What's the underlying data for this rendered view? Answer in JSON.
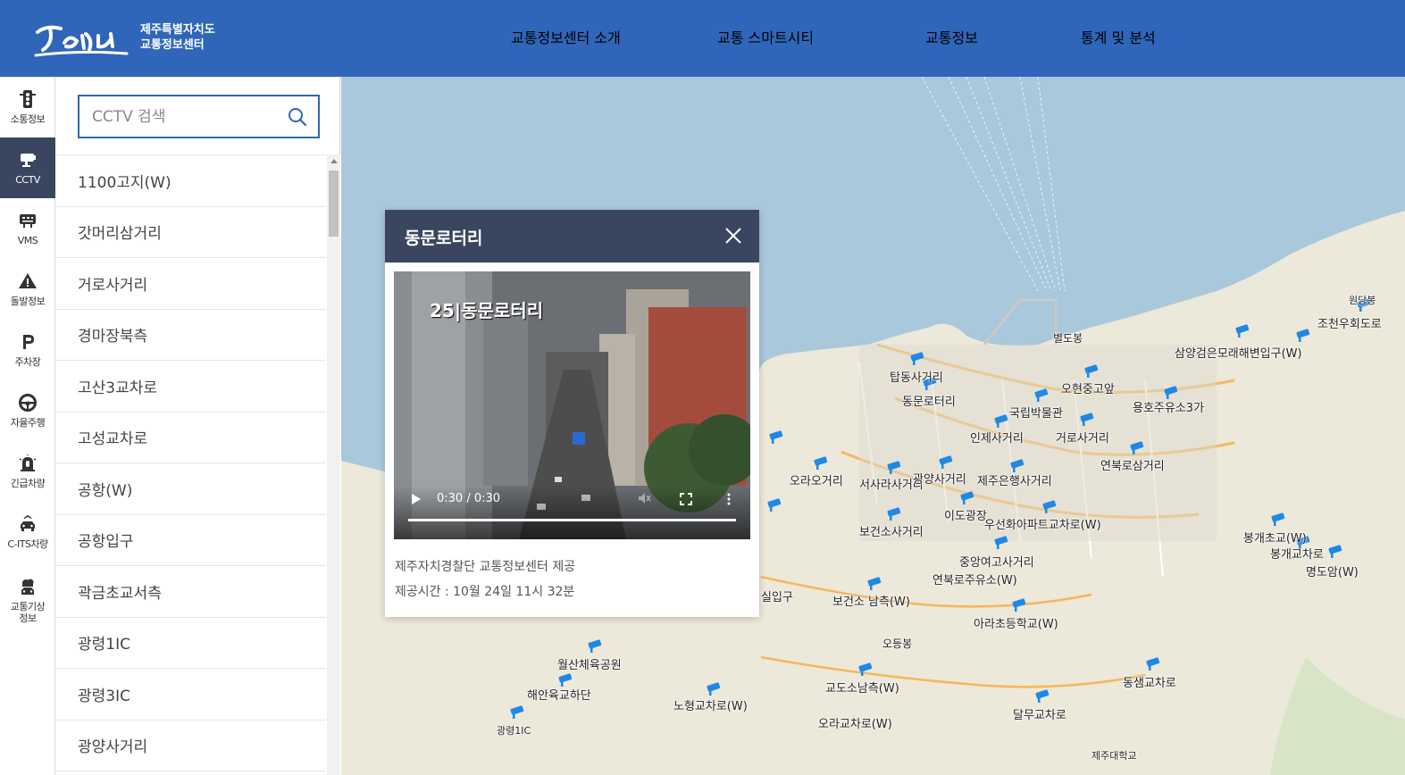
{
  "header": {
    "logo_text": "Jeju",
    "org_line1": "제주특별자치도",
    "org_line2": "교통정보센터",
    "nav": [
      "교통정보센터 소개",
      "교통 스마트시티",
      "교통정보",
      "통계 및 분석"
    ]
  },
  "rail": [
    {
      "label": "소통정보",
      "icon": "traffic-light-icon"
    },
    {
      "label": "CCTV",
      "icon": "cctv-icon",
      "active": true
    },
    {
      "label": "VMS",
      "icon": "vms-icon"
    },
    {
      "label": "돌발정보",
      "icon": "warning-icon"
    },
    {
      "label": "주차장",
      "icon": "parking-icon"
    },
    {
      "label": "자율주행",
      "icon": "steering-wheel-icon"
    },
    {
      "label": "긴급차량",
      "icon": "emergency-icon"
    },
    {
      "label": "C-ITS차량",
      "icon": "car-icon"
    },
    {
      "label": "교통기상\n정보",
      "icon": "weather-icon"
    }
  ],
  "search": {
    "placeholder": "CCTV 검색"
  },
  "list": [
    "1100고지(W)",
    "갓머리삼거리",
    "거로사거리",
    "경마장북측",
    "고산3교차로",
    "고성교차로",
    "공항(W)",
    "공항입구",
    "곽금초교서측",
    "광령1IC",
    "광령3IC",
    "광양사거리"
  ],
  "popup": {
    "title": "동문로터리",
    "video_overlay": "25|동문로터리",
    "video_time": "0:30 / 0:30",
    "provider": "제주자치경찰단 교통정보센터 제공",
    "timestamp": "제공시간 : 10월 24일 11시 32분"
  },
  "map": {
    "labels": [
      "탑동사거리",
      "동문로터리",
      "오현중고앞",
      "국립박물관",
      "용호주유소3가",
      "인제사거리",
      "거로사거리",
      "연북로삼거리",
      "오라오거리",
      "서사라사거리",
      "광양사거리",
      "제주은행사거리",
      "이도광장",
      "우선화아파트교차로(W)",
      "보건소사거리",
      "중앙여고사거리",
      "연북로주유소(W)",
      "보건소 남측(W)",
      "아라초등학교(W)",
      "월산체육공원",
      "해안육교하단",
      "노형교차로(W)",
      "교도소남측(W)",
      "오라교차로(W)",
      "달무교차로",
      "동샘교차로",
      "광령1IC",
      "봉개초교(W)",
      "봉개교차로",
      "명도암(W)",
      "조천우회도로",
      "삼양검은모래해변입구(W)",
      "별도봉",
      "오등봉",
      "제주대학교",
      "실입구",
      "원당봉"
    ],
    "colors": {
      "sea": "#a9c8dc",
      "land": "#ece8da",
      "cam": "#1e88e5"
    }
  }
}
